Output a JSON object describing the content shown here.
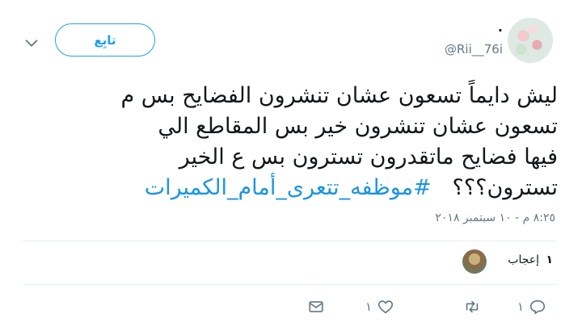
{
  "header": {
    "display_name": ".",
    "handle": "@Rii__76i",
    "follow_label": "تابِع"
  },
  "tweet": {
    "text_lines": [
      "ليش دايماً تسعون عشان تنشرون الفضايح بس م",
      "تسعون عشان تنشرون خير  بس المقاطع الي",
      "فيها فضايح ماتقدرون تسترون بس ع الخير"
    ],
    "text_last_line": "تسترون؟؟؟",
    "hashtag": "#موظفه_تتعرى_أمام_الكميرات",
    "timestamp": "٨:٢٥ م - ١٠ سبتمبر ٢٠١٨"
  },
  "engagement": {
    "likes_number": "١",
    "likes_label": "إعجاب"
  },
  "actions": {
    "reply_count": "١",
    "retweet_count": "",
    "like_count": "١"
  },
  "colors": {
    "accent": "#1da1f2",
    "muted": "#657786",
    "divider": "#e6ecf0"
  }
}
